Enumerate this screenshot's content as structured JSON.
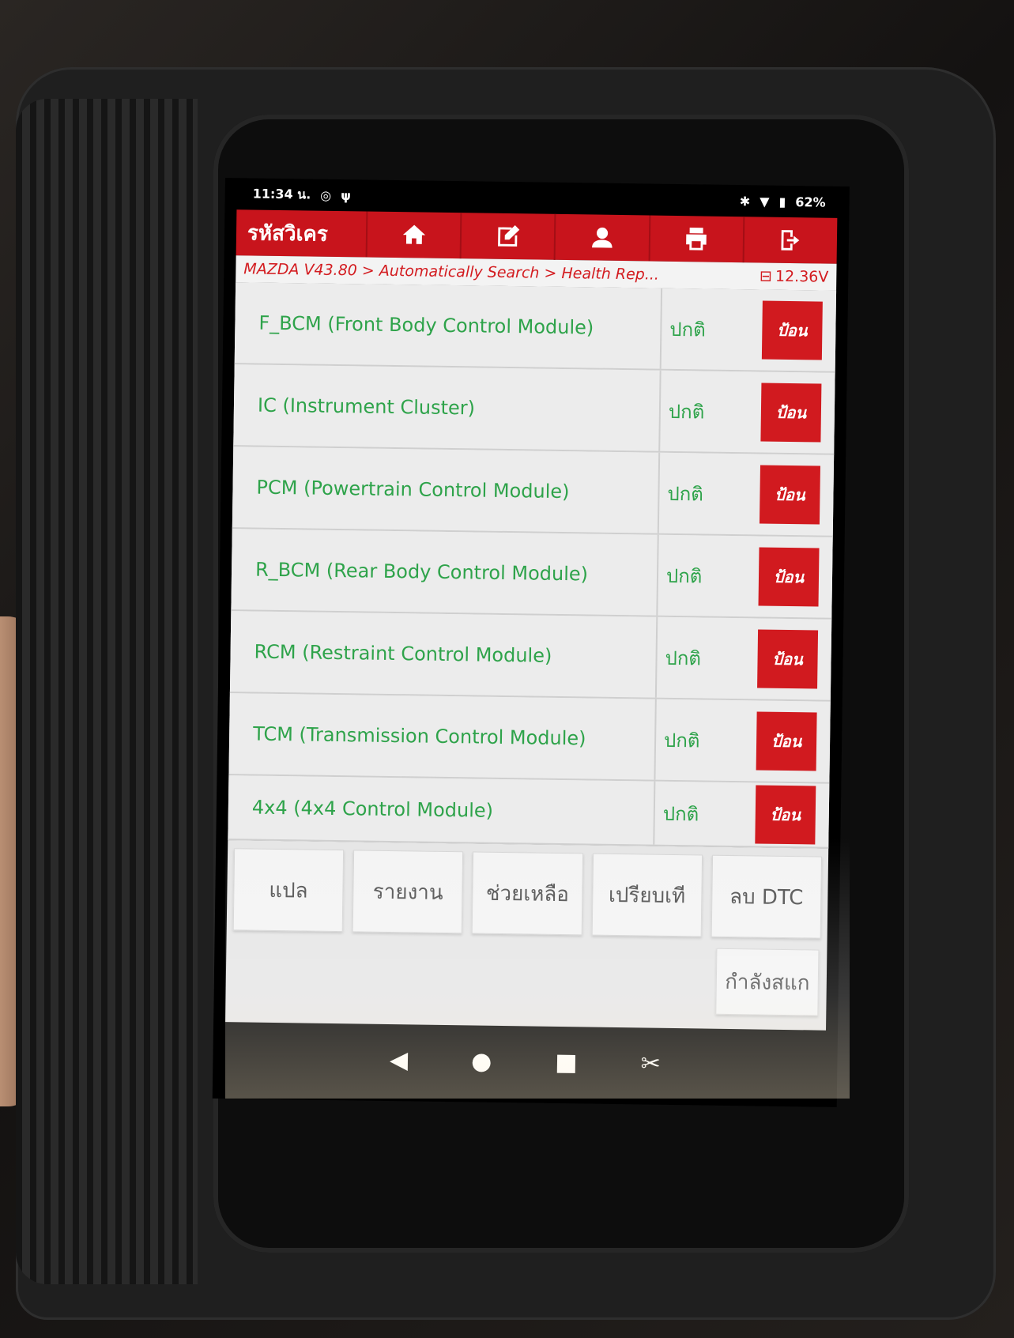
{
  "status_bar": {
    "time": "11:34 น.",
    "battery": "62%"
  },
  "toolbar": {
    "title": "รหัสวิเคร",
    "icons": [
      "home-icon",
      "edit-icon",
      "user-icon",
      "print-icon",
      "exit-icon"
    ]
  },
  "breadcrumb": {
    "path": "MAZDA V43.80 > Automatically Search > Health Rep...",
    "voltage": "12.36V"
  },
  "modules": [
    {
      "name": "F_BCM (Front Body Control Module)",
      "status": "ปกติ",
      "action": "ป้อน"
    },
    {
      "name": "IC (Instrument Cluster)",
      "status": "ปกติ",
      "action": "ป้อน"
    },
    {
      "name": "PCM (Powertrain Control Module)",
      "status": "ปกติ",
      "action": "ป้อน"
    },
    {
      "name": "R_BCM (Rear Body Control Module)",
      "status": "ปกติ",
      "action": "ป้อน"
    },
    {
      "name": "RCM (Restraint Control Module)",
      "status": "ปกติ",
      "action": "ป้อน"
    },
    {
      "name": "TCM (Transmission Control Module)",
      "status": "ปกติ",
      "action": "ป้อน"
    },
    {
      "name": "4x4 (4x4 Control Module)",
      "status": "ปกติ",
      "action": "ป้อน"
    }
  ],
  "buttons": {
    "translate": "แปล",
    "report": "รายงาน",
    "help": "ช่วยเหลือ",
    "compare": "เปรียบเที",
    "clear_dtc": "ลบ DTC",
    "scanning": "กำลังสแก"
  },
  "navbar": {
    "back": "◀",
    "home": "●",
    "recents": "■"
  },
  "colors": {
    "toolbar": "#c8141c",
    "module_text": "#2ea34a",
    "action_button": "#d11a1f"
  }
}
